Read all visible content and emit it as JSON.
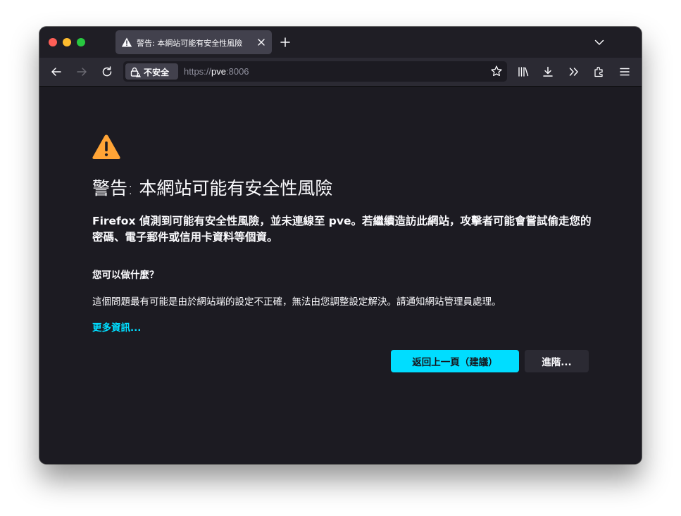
{
  "tab": {
    "title": "警告: 本網站可能有安全性風險",
    "icon": "warning-icon"
  },
  "urlbar": {
    "identity_label": "不安全",
    "url_prefix": "https://",
    "url_host": "pve",
    "url_suffix": ":8006"
  },
  "page": {
    "title": "警告: 本網站可能有安全性風險",
    "desc_before": "Firefox 偵測到可能有安全性風險，並未連線至 ",
    "desc_host": "pve",
    "desc_after": "。若繼續造訪此網站，攻擊者可能會嘗試偷走您的密碼、電子郵件或信用卡資料等個資。",
    "subheading": "您可以做什麼？",
    "advice": "這個問題最有可能是由於網站端的設定不正確，無法由您調整設定解決。請通知網站管理員處理。",
    "learn_more": "更多資訊...",
    "go_back": "返回上一頁（建議）",
    "advanced": "進階..."
  },
  "colors": {
    "accent": "#00ddff",
    "warning": "#ffa436",
    "background": "#1c1b22",
    "text": "#fbfbfe"
  }
}
